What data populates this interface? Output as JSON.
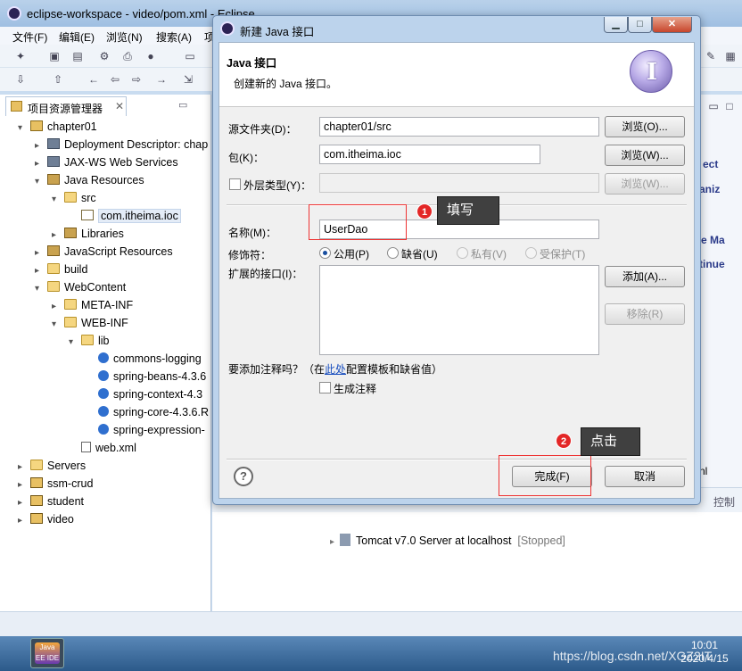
{
  "eclipse": {
    "title": "eclipse-workspace - video/pom.xml - Eclipse",
    "menu": [
      "文件(F)",
      "编辑(E)",
      "浏览(N)",
      "搜索(A)",
      "项"
    ],
    "explorer_tab": "项目资源管理器",
    "tree": [
      {
        "label": "chapter01",
        "icon": "project-icon",
        "indent": 0,
        "arrow": "▾"
      },
      {
        "label": "Deployment Descriptor: chap",
        "icon": "descriptor-icon",
        "indent": 1,
        "arrow": "▸"
      },
      {
        "label": "JAX-WS Web Services",
        "icon": "webservice-icon",
        "indent": 1,
        "arrow": "▸"
      },
      {
        "label": "Java Resources",
        "icon": "java-resources-icon",
        "indent": 1,
        "arrow": "▾"
      },
      {
        "label": "src",
        "icon": "source-folder-icon",
        "indent": 2,
        "arrow": "▾"
      },
      {
        "label": "com.itheima.ioc",
        "icon": "package-icon",
        "indent": 3,
        "arrow": "",
        "selected": true
      },
      {
        "label": "Libraries",
        "icon": "library-icon",
        "indent": 2,
        "arrow": "▸"
      },
      {
        "label": "JavaScript Resources",
        "icon": "js-resources-icon",
        "indent": 1,
        "arrow": "▸"
      },
      {
        "label": "build",
        "icon": "folder-icon",
        "indent": 1,
        "arrow": "▸"
      },
      {
        "label": "WebContent",
        "icon": "folder-icon",
        "indent": 1,
        "arrow": "▾"
      },
      {
        "label": "META-INF",
        "icon": "folder-icon",
        "indent": 2,
        "arrow": "▸"
      },
      {
        "label": "WEB-INF",
        "icon": "folder-icon",
        "indent": 2,
        "arrow": "▾"
      },
      {
        "label": "lib",
        "icon": "folder-icon",
        "indent": 3,
        "arrow": "▾"
      },
      {
        "label": "commons-logging",
        "icon": "jar-icon",
        "indent": 4,
        "arrow": ""
      },
      {
        "label": "spring-beans-4.3.6",
        "icon": "jar-icon",
        "indent": 4,
        "arrow": ""
      },
      {
        "label": "spring-context-4.3",
        "icon": "jar-icon",
        "indent": 4,
        "arrow": ""
      },
      {
        "label": "spring-core-4.3.6.R",
        "icon": "jar-icon",
        "indent": 4,
        "arrow": ""
      },
      {
        "label": "spring-expression-",
        "icon": "jar-icon",
        "indent": 4,
        "arrow": ""
      },
      {
        "label": "web.xml",
        "icon": "xml-file-icon",
        "indent": 3,
        "arrow": ""
      },
      {
        "label": "Servers",
        "icon": "folder-icon",
        "indent": 0,
        "arrow": "▸"
      },
      {
        "label": "ssm-crud",
        "icon": "javaee-project-icon",
        "indent": 0,
        "arrow": "▸"
      },
      {
        "label": "student",
        "icon": "javaee-project-icon",
        "indent": 0,
        "arrow": "▸"
      },
      {
        "label": "video",
        "icon": "javaee-project-icon",
        "indent": 0,
        "arrow": "▸"
      }
    ],
    "right_fragments": {
      "a": "ect",
      "b": "aniz",
      "c": "e Ma",
      "d": "tinue",
      "e": "nl",
      "f": "控制"
    },
    "server_entry": {
      "name": "Tomcat v7.0 Server at localhost",
      "status": "[Stopped]"
    },
    "clock": {
      "time": "10:01",
      "date": "2020/4/15"
    },
    "watermark": "https://blog.csdn.net/XGZ2IT",
    "taskbar_app_label": "Java EE IDE"
  },
  "dialog": {
    "title": "新建 Java 接口",
    "header_title": "Java 接口",
    "header_desc": "创建新的 Java 接口。",
    "header_icon_letter": "I",
    "source_folder": {
      "label": "源文件夹(D)：",
      "value": "chapter01/src",
      "browse": "浏览(O)..."
    },
    "package": {
      "label": "包(K)：",
      "value": "com.itheima.ioc",
      "browse": "浏览(W)..."
    },
    "enclosing": {
      "label": "外层类型(Y)：",
      "value": "",
      "browse": "浏览(W)..."
    },
    "name": {
      "label": "名称(M)：",
      "value": "UserDao"
    },
    "modifier": {
      "label": "修饰符：",
      "options": [
        "公用(P)",
        "缺省(U)",
        "私有(V)",
        "受保护(T)"
      ],
      "selected": 0
    },
    "extends": {
      "label": "扩展的接口(I)：",
      "add": "添加(A)...",
      "remove": "移除(R)"
    },
    "comment": {
      "prefix": "要添加注释吗？（在",
      "link": "此处",
      "suffix": "配置模板和缺省值）",
      "checkbox": "生成注释"
    },
    "finish": "完成(F)",
    "cancel": "取消",
    "help": "?"
  },
  "annotations": {
    "step1": {
      "number": "1",
      "text": "填写"
    },
    "step2": {
      "number": "2",
      "text": "点击"
    }
  }
}
